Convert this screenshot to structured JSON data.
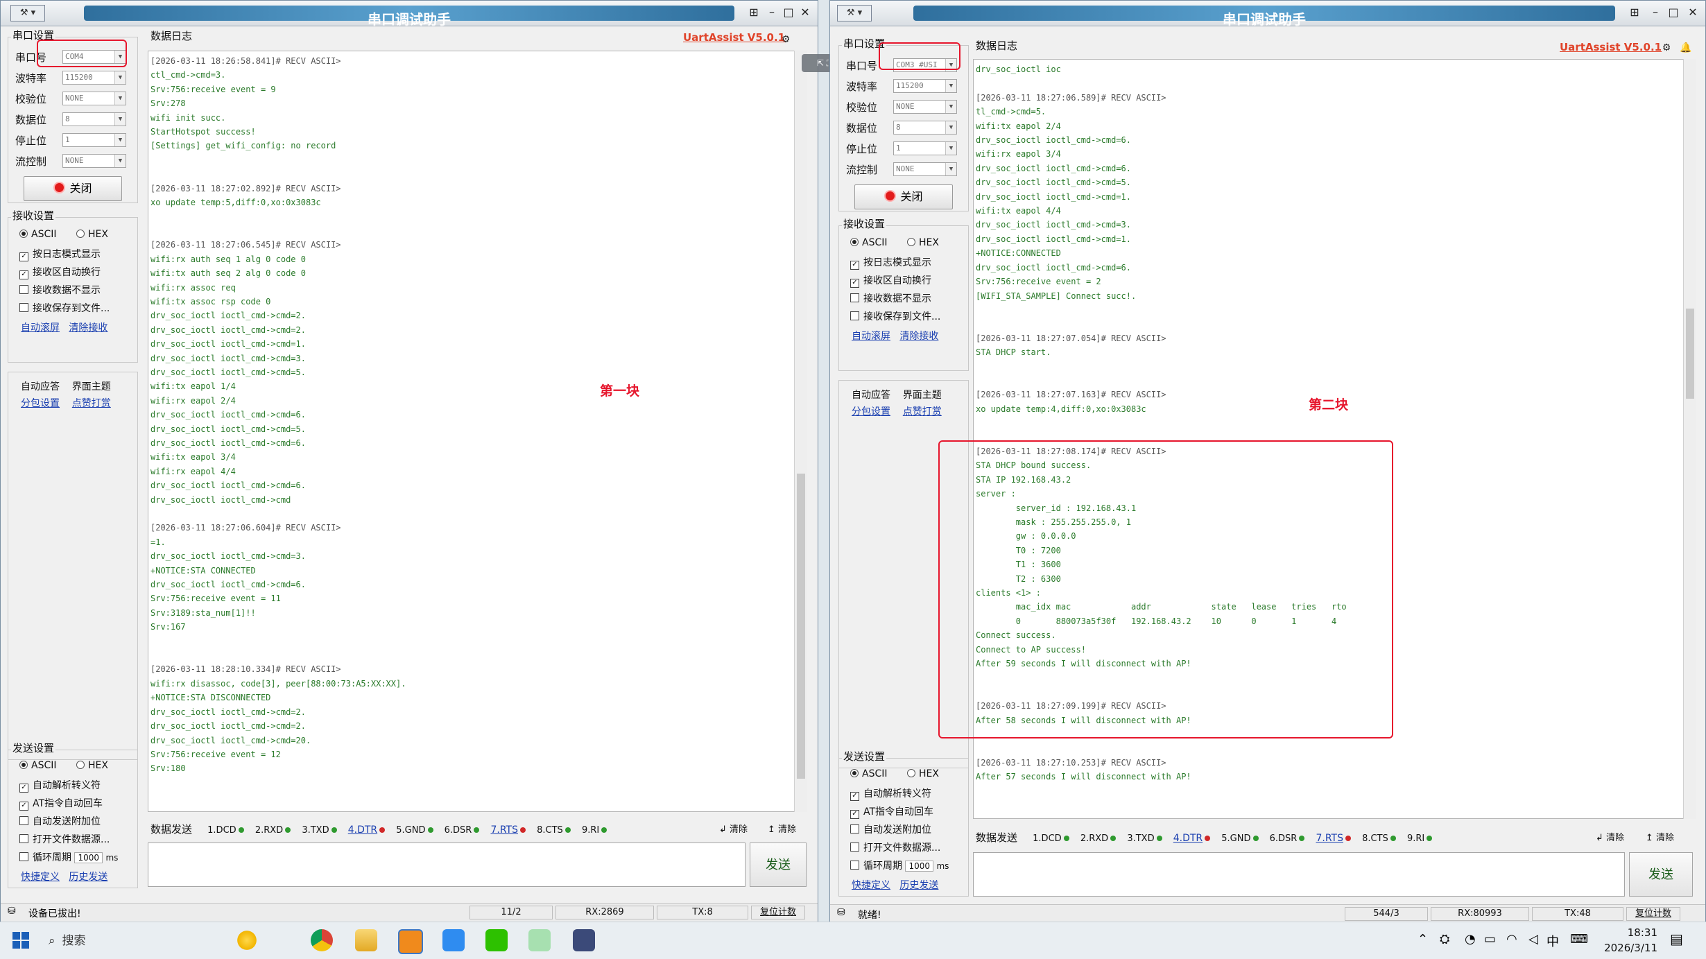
{
  "app_title": "串口调试助手",
  "version": "UartAssist V5.0.1",
  "tab_label": "数据日志",
  "left_labels": {
    "serial_group": "串口设置",
    "port": "串口号",
    "baud": "波特率",
    "parity": "校验位",
    "databits": "数据位",
    "stopbits": "停止位",
    "flow": "流控制",
    "close": "关闭",
    "recv_group": "接收设置",
    "ascii": "ASCII",
    "hex": "HEX",
    "recv_opt1": "按日志模式显示",
    "recv_opt2": "接收区自动换行",
    "recv_opt3": "接收数据不显示",
    "recv_opt4": "接收保存到文件...",
    "link_autoclear": "自动滚屏",
    "link_clear": "清除接收",
    "menu1": "自动应答",
    "menu2": "界面主题",
    "menu3": "分包设置",
    "menu4": "点赞打赏",
    "send_group": "发送设置",
    "send_opt1": "自动解析转义符",
    "send_opt2": "AT指令自动回车",
    "send_opt3": "自动发送附加位",
    "send_opt4": "打开文件数据源...",
    "send_opt5": "循环周期",
    "cycle_val": "1000",
    "cycle_unit": "ms",
    "link_shortcut": "快捷定义",
    "link_history": "历史发送"
  },
  "values_common": {
    "baud": "115200",
    "parity": "NONE",
    "databits": "8",
    "stopbits": "1",
    "flow": "NONE"
  },
  "send_bar": {
    "label": "数据发送",
    "signals": [
      "1.DCD",
      "2.RXD",
      "3.TXD",
      "4.DTR",
      "5.GND",
      "6.DSR",
      "7.RTS",
      "8.CTS",
      "9.RI"
    ],
    "clear1": "清除",
    "clear2": "清除",
    "send": "发送"
  },
  "left_window": {
    "port": "COM4",
    "status": "设备已拔出!",
    "count": "11/2",
    "rx": "RX:2869",
    "tx": "TX:8",
    "reset": "复位计数",
    "annotation": "第一块",
    "log": [
      {
        "t": "ts",
        "s": "[2026-03-11 18:26:58.841]# RECV ASCII>"
      },
      {
        "t": "d",
        "s": "ctl_cmd->cmd=3."
      },
      {
        "t": "d",
        "s": "Srv:756:receive event = 9"
      },
      {
        "t": "d",
        "s": "Srv:278"
      },
      {
        "t": "d",
        "s": "wifi init succ."
      },
      {
        "t": "d",
        "s": "StartHotspot success!"
      },
      {
        "t": "d",
        "s": "[Settings] get_wifi_config: no record"
      },
      {
        "t": "d",
        "s": ""
      },
      {
        "t": "d",
        "s": ""
      },
      {
        "t": "ts",
        "s": "[2026-03-11 18:27:02.892]# RECV ASCII>"
      },
      {
        "t": "d",
        "s": "xo update temp:5,diff:0,xo:0x3083c"
      },
      {
        "t": "d",
        "s": ""
      },
      {
        "t": "d",
        "s": ""
      },
      {
        "t": "ts",
        "s": "[2026-03-11 18:27:06.545]# RECV ASCII>"
      },
      {
        "t": "d",
        "s": "wifi:rx auth seq 1 alg 0 code 0"
      },
      {
        "t": "d",
        "s": "wifi:tx auth seq 2 alg 0 code 0"
      },
      {
        "t": "d",
        "s": "wifi:rx assoc req"
      },
      {
        "t": "d",
        "s": "wifi:tx assoc rsp code 0"
      },
      {
        "t": "d",
        "s": "drv_soc_ioctl ioctl_cmd->cmd=2."
      },
      {
        "t": "d",
        "s": "drv_soc_ioctl ioctl_cmd->cmd=2."
      },
      {
        "t": "d",
        "s": "drv_soc_ioctl ioctl_cmd->cmd=1."
      },
      {
        "t": "d",
        "s": "drv_soc_ioctl ioctl_cmd->cmd=3."
      },
      {
        "t": "d",
        "s": "drv_soc_ioctl ioctl_cmd->cmd=5."
      },
      {
        "t": "d",
        "s": "wifi:tx eapol 1/4"
      },
      {
        "t": "d",
        "s": "wifi:rx eapol 2/4"
      },
      {
        "t": "d",
        "s": "drv_soc_ioctl ioctl_cmd->cmd=6."
      },
      {
        "t": "d",
        "s": "drv_soc_ioctl ioctl_cmd->cmd=5."
      },
      {
        "t": "d",
        "s": "drv_soc_ioctl ioctl_cmd->cmd=6."
      },
      {
        "t": "d",
        "s": "wifi:tx eapol 3/4"
      },
      {
        "t": "d",
        "s": "wifi:rx eapol 4/4"
      },
      {
        "t": "d",
        "s": "drv_soc_ioctl ioctl_cmd->cmd=6."
      },
      {
        "t": "d",
        "s": "drv_soc_ioctl ioctl_cmd->cmd"
      },
      {
        "t": "d",
        "s": ""
      },
      {
        "t": "ts",
        "s": "[2026-03-11 18:27:06.604]# RECV ASCII>"
      },
      {
        "t": "d",
        "s": "=1."
      },
      {
        "t": "d",
        "s": "drv_soc_ioctl ioctl_cmd->cmd=3."
      },
      {
        "t": "d",
        "s": "+NOTICE:STA CONNECTED"
      },
      {
        "t": "d",
        "s": "drv_soc_ioctl ioctl_cmd->cmd=6."
      },
      {
        "t": "d",
        "s": "Srv:756:receive event = 11"
      },
      {
        "t": "d",
        "s": "Srv:3189:sta_num[1]!!"
      },
      {
        "t": "d",
        "s": "Srv:167"
      },
      {
        "t": "d",
        "s": ""
      },
      {
        "t": "d",
        "s": ""
      },
      {
        "t": "ts",
        "s": "[2026-03-11 18:28:10.334]# RECV ASCII>"
      },
      {
        "t": "d",
        "s": "wifi:rx disassoc, code[3], peer[88:00:73:A5:XX:XX]."
      },
      {
        "t": "d",
        "s": "+NOTICE:STA DISCONNECTED"
      },
      {
        "t": "d",
        "s": "drv_soc_ioctl ioctl_cmd->cmd=2."
      },
      {
        "t": "d",
        "s": "drv_soc_ioctl ioctl_cmd->cmd=2."
      },
      {
        "t": "d",
        "s": "drv_soc_ioctl ioctl_cmd->cmd=20."
      },
      {
        "t": "d",
        "s": "Srv:756:receive event = 12"
      },
      {
        "t": "d",
        "s": "Srv:180"
      }
    ]
  },
  "right_window": {
    "port": "COM3 #USI",
    "status": "就绪!",
    "count": "544/3",
    "rx": "RX:80993",
    "tx": "TX:48",
    "reset": "复位计数",
    "annotation": "第二块",
    "log": [
      {
        "t": "d",
        "s": "drv_soc_ioctl ioc"
      },
      {
        "t": "d",
        "s": ""
      },
      {
        "t": "ts",
        "s": "[2026-03-11 18:27:06.589]# RECV ASCII>"
      },
      {
        "t": "d",
        "s": "tl_cmd->cmd=5."
      },
      {
        "t": "d",
        "s": "wifi:tx eapol 2/4"
      },
      {
        "t": "d",
        "s": "drv_soc_ioctl ioctl_cmd->cmd=6."
      },
      {
        "t": "d",
        "s": "wifi:rx eapol 3/4"
      },
      {
        "t": "d",
        "s": "drv_soc_ioctl ioctl_cmd->cmd=6."
      },
      {
        "t": "d",
        "s": "drv_soc_ioctl ioctl_cmd->cmd=5."
      },
      {
        "t": "d",
        "s": "drv_soc_ioctl ioctl_cmd->cmd=1."
      },
      {
        "t": "d",
        "s": "wifi:tx eapol 4/4"
      },
      {
        "t": "d",
        "s": "drv_soc_ioctl ioctl_cmd->cmd=3."
      },
      {
        "t": "d",
        "s": "drv_soc_ioctl ioctl_cmd->cmd=1."
      },
      {
        "t": "d",
        "s": "+NOTICE:CONNECTED"
      },
      {
        "t": "d",
        "s": "drv_soc_ioctl ioctl_cmd->cmd=6."
      },
      {
        "t": "d",
        "s": "Srv:756:receive event = 2"
      },
      {
        "t": "d",
        "s": "[WIFI_STA_SAMPLE] Connect succ!."
      },
      {
        "t": "d",
        "s": ""
      },
      {
        "t": "d",
        "s": ""
      },
      {
        "t": "ts",
        "s": "[2026-03-11 18:27:07.054]# RECV ASCII>"
      },
      {
        "t": "d",
        "s": "STA DHCP start."
      },
      {
        "t": "d",
        "s": ""
      },
      {
        "t": "d",
        "s": ""
      },
      {
        "t": "ts",
        "s": "[2026-03-11 18:27:07.163]# RECV ASCII>"
      },
      {
        "t": "d",
        "s": "xo update temp:4,diff:0,xo:0x3083c"
      },
      {
        "t": "d",
        "s": ""
      },
      {
        "t": "d",
        "s": ""
      },
      {
        "t": "ts",
        "s": "[2026-03-11 18:27:08.174]# RECV ASCII>"
      },
      {
        "t": "d",
        "s": "STA DHCP bound success."
      },
      {
        "t": "d",
        "s": "STA IP 192.168.43.2"
      },
      {
        "t": "d",
        "s": "server :"
      },
      {
        "t": "d",
        "s": "        server_id : 192.168.43.1"
      },
      {
        "t": "d",
        "s": "        mask : 255.255.255.0, 1"
      },
      {
        "t": "d",
        "s": "        gw : 0.0.0.0"
      },
      {
        "t": "d",
        "s": "        T0 : 7200"
      },
      {
        "t": "d",
        "s": "        T1 : 3600"
      },
      {
        "t": "d",
        "s": "        T2 : 6300"
      },
      {
        "t": "d",
        "s": "clients <1> :"
      },
      {
        "t": "d",
        "s": "        mac_idx mac            addr            state   lease   tries   rto"
      },
      {
        "t": "d",
        "s": "        0       880073a5f30f   192.168.43.2    10      0       1       4"
      },
      {
        "t": "d",
        "s": "Connect success."
      },
      {
        "t": "d",
        "s": "Connect to AP success!"
      },
      {
        "t": "d",
        "s": "After 59 seconds I will disconnect with AP!"
      },
      {
        "t": "d",
        "s": ""
      },
      {
        "t": "d",
        "s": ""
      },
      {
        "t": "ts",
        "s": "[2026-03-11 18:27:09.199]# RECV ASCII>"
      },
      {
        "t": "d",
        "s": "After 58 seconds I will disconnect with AP!"
      },
      {
        "t": "d",
        "s": ""
      },
      {
        "t": "d",
        "s": ""
      },
      {
        "t": "ts",
        "s": "[2026-03-11 18:27:10.253]# RECV ASCII>"
      },
      {
        "t": "d",
        "s": "After 57 seconds I will disconnect with AP!"
      }
    ]
  },
  "taskbar": {
    "search": "搜索",
    "time": "18:31",
    "date": "2026/3/11",
    "ime": "中"
  },
  "colors": {
    "red_annotation": "#e6162d",
    "log_green": "#2a7a2a",
    "title_blue": "#2f6f9d"
  }
}
